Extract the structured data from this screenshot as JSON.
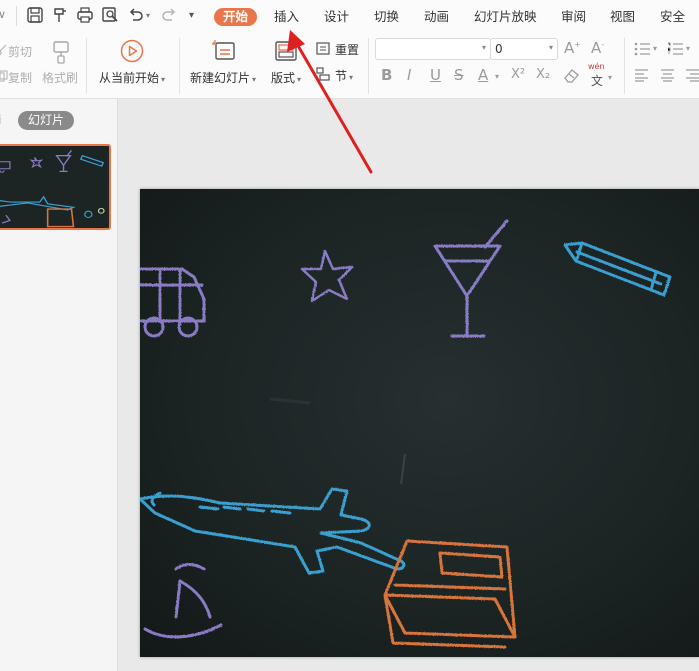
{
  "menu": {
    "tabs": [
      {
        "label": "开始",
        "active": true
      },
      {
        "label": "插入",
        "active": false
      },
      {
        "label": "设计",
        "active": false
      },
      {
        "label": "切换",
        "active": false
      },
      {
        "label": "动画",
        "active": false
      },
      {
        "label": "幻灯片放映",
        "active": false
      },
      {
        "label": "审阅",
        "active": false
      },
      {
        "label": "视图",
        "active": false
      },
      {
        "label": "安全",
        "active": false
      }
    ],
    "quick_access_icons": [
      "save-icon",
      "format-painter-icon",
      "print-icon",
      "print-preview-icon",
      "undo-icon",
      "redo-icon",
      "customize-icon"
    ]
  },
  "ribbon": {
    "cut_label": "剪切",
    "copy_label": "复制",
    "format_painter_label": "格式刷",
    "play_from_current_label": "从当前开始",
    "new_slide_label": "新建幻灯片",
    "layout_label": "版式",
    "reset_label": "重置",
    "section_label": "节",
    "font_name_value": "",
    "font_size_value": "0",
    "format_buttons": [
      "B",
      "I",
      "U",
      "S",
      "A",
      "X²",
      "X₂"
    ],
    "wen_label": "wén",
    "wen_char": "文"
  },
  "left_panel": {
    "outline_tab_fragment": "i",
    "slides_tab_label": "幻灯片"
  },
  "colors": {
    "accent": "#e9764a",
    "annotation_arrow": "#e02020",
    "slide_background": "#1c2424",
    "chalk_purple": "#8a7bc4",
    "chalk_blue": "#3aa0d0",
    "chalk_orange": "#d9753a"
  }
}
